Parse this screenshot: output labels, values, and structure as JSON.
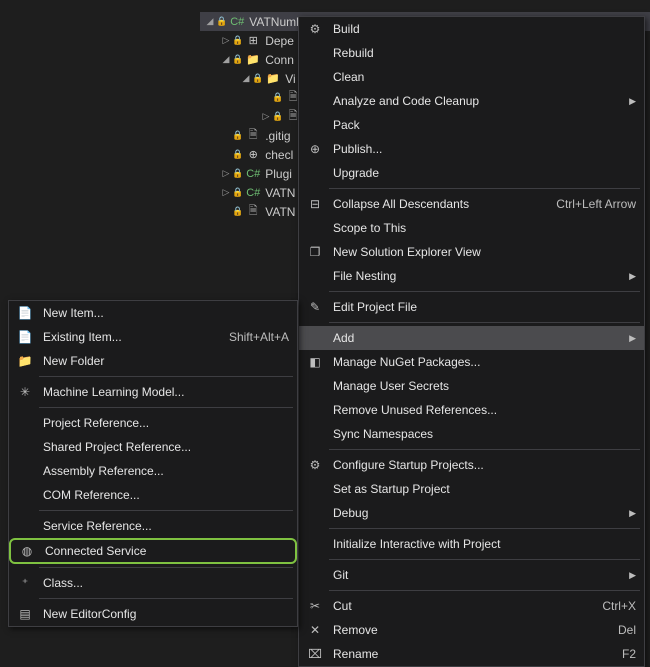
{
  "tree": {
    "root": "VATNumberValidatorPlugin",
    "items": [
      "Depe",
      "Conn",
      "Vi",
      "",
      "",
      ".gitig",
      "checl",
      "Plugi",
      "VATN",
      "VATN"
    ]
  },
  "right_menu": {
    "items": [
      {
        "label": "Build",
        "icon": "build-icon"
      },
      {
        "label": "Rebuild"
      },
      {
        "label": "Clean"
      },
      {
        "label": "Analyze and Code Cleanup",
        "sub": true
      },
      {
        "label": "Pack"
      },
      {
        "label": "Publish...",
        "icon": "publish-icon"
      },
      {
        "label": "Upgrade"
      },
      {
        "sep": true
      },
      {
        "label": "Collapse All Descendants",
        "icon": "collapse-icon",
        "shortcut": "Ctrl+Left Arrow"
      },
      {
        "label": "Scope to This"
      },
      {
        "label": "New Solution Explorer View",
        "icon": "newview-icon"
      },
      {
        "label": "File Nesting",
        "sub": true
      },
      {
        "sep": true
      },
      {
        "label": "Edit Project File",
        "icon": "edit-icon"
      },
      {
        "sep": true
      },
      {
        "label": "Add",
        "sub": true,
        "highlighted": true
      },
      {
        "label": "Manage NuGet Packages...",
        "icon": "nuget-icon"
      },
      {
        "label": "Manage User Secrets"
      },
      {
        "label": "Remove Unused References..."
      },
      {
        "label": "Sync Namespaces"
      },
      {
        "sep": true
      },
      {
        "label": "Configure Startup Projects...",
        "icon": "startup-icon"
      },
      {
        "label": "Set as Startup Project"
      },
      {
        "label": "Debug",
        "sub": true
      },
      {
        "sep": true
      },
      {
        "label": "Initialize Interactive with Project"
      },
      {
        "sep": true
      },
      {
        "label": "Git",
        "sub": true
      },
      {
        "sep": true
      },
      {
        "label": "Cut",
        "icon": "cut-icon",
        "shortcut": "Ctrl+X"
      },
      {
        "label": "Remove",
        "icon": "remove-icon",
        "shortcut": "Del"
      },
      {
        "label": "Rename",
        "icon": "rename-icon",
        "shortcut": "F2"
      }
    ]
  },
  "left_menu": {
    "items": [
      {
        "label": "New Item...",
        "icon": "newitem-icon"
      },
      {
        "label": "Existing Item...",
        "icon": "existing-icon",
        "shortcut": "Shift+Alt+A"
      },
      {
        "label": "New Folder",
        "icon": "newfolder-icon"
      },
      {
        "sep": true
      },
      {
        "label": "Machine Learning Model...",
        "icon": "ml-icon"
      },
      {
        "sep": true
      },
      {
        "label": "Project Reference..."
      },
      {
        "label": "Shared Project Reference..."
      },
      {
        "label": "Assembly Reference..."
      },
      {
        "label": "COM Reference..."
      },
      {
        "sep": true
      },
      {
        "label": "Service Reference..."
      },
      {
        "label": "Connected Service",
        "icon": "connected-icon",
        "green": true
      },
      {
        "sep": true
      },
      {
        "label": "Class...",
        "icon": "class-icon"
      },
      {
        "sep": true
      },
      {
        "label": "New EditorConfig",
        "icon": "editorconfig-icon"
      }
    ]
  }
}
